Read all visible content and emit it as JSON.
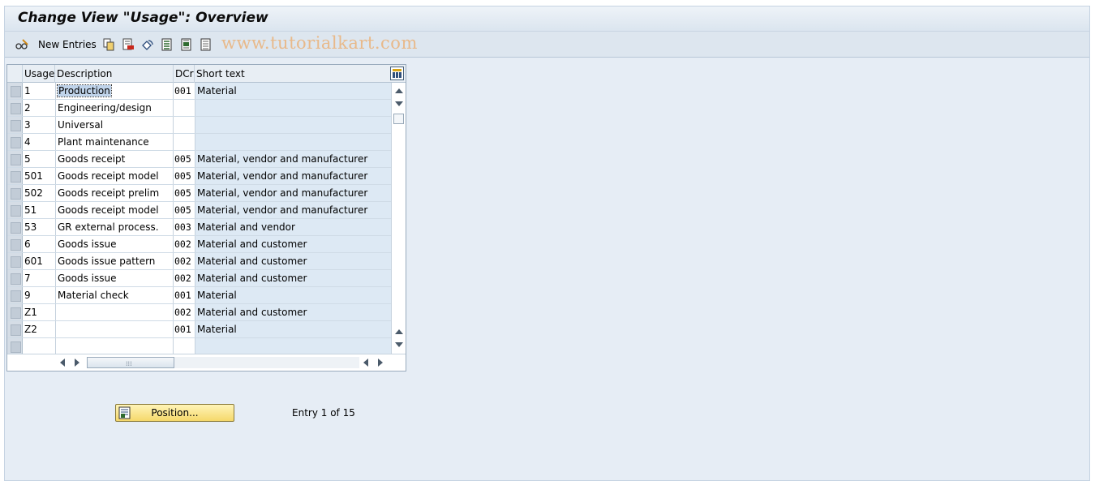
{
  "title": "Change View \"Usage\": Overview",
  "toolbar": {
    "new_entries_label": "New Entries",
    "watermark": "www.tutorialkart.com"
  },
  "table": {
    "headers": {
      "usage": "Usage",
      "description": "Description",
      "dcr": "DCr",
      "short_text": "Short text"
    },
    "rows": [
      {
        "usage": "1",
        "description": "Production",
        "dcr": "001",
        "short_text": "Material"
      },
      {
        "usage": "2",
        "description": "Engineering/design",
        "dcr": "",
        "short_text": ""
      },
      {
        "usage": "3",
        "description": "Universal",
        "dcr": "",
        "short_text": ""
      },
      {
        "usage": "4",
        "description": "Plant maintenance",
        "dcr": "",
        "short_text": ""
      },
      {
        "usage": "5",
        "description": "Goods receipt",
        "dcr": "005",
        "short_text": "Material, vendor and manufacturer"
      },
      {
        "usage": "501",
        "description": "Goods receipt model",
        "dcr": "005",
        "short_text": "Material, vendor and manufacturer"
      },
      {
        "usage": "502",
        "description": "Goods receipt prelim",
        "dcr": "005",
        "short_text": "Material, vendor and manufacturer"
      },
      {
        "usage": "51",
        "description": "Goods receipt model",
        "dcr": "005",
        "short_text": "Material, vendor and manufacturer"
      },
      {
        "usage": "53",
        "description": "GR external process.",
        "dcr": "003",
        "short_text": "Material and vendor"
      },
      {
        "usage": "6",
        "description": "Goods issue",
        "dcr": "002",
        "short_text": "Material and customer"
      },
      {
        "usage": "601",
        "description": "Goods issue pattern",
        "dcr": "002",
        "short_text": "Material and customer"
      },
      {
        "usage": "7",
        "description": "Goods issue",
        "dcr": "002",
        "short_text": "Material and customer"
      },
      {
        "usage": "9",
        "description": "Material check",
        "dcr": "001",
        "short_text": "Material"
      },
      {
        "usage": "Z1",
        "description": "",
        "dcr": "002",
        "short_text": "Material and customer"
      },
      {
        "usage": "Z2",
        "description": "",
        "dcr": "001",
        "short_text": "Material"
      },
      {
        "usage": "",
        "description": "",
        "dcr": "",
        "short_text": ""
      }
    ]
  },
  "position_button_label": "Position...",
  "entry_info": "Entry 1 of 15",
  "icons": {
    "toolbar": [
      "glasses-edit-icon",
      "copy-icon",
      "delete-icon",
      "undo-change-icon",
      "select-all-icon",
      "select-block-icon",
      "deselect-all-icon"
    ],
    "position": "position-icon"
  },
  "colors": {
    "background": "#e6edf5",
    "selection_highlight": "#bfd3ea",
    "button": "#f5d86a"
  }
}
